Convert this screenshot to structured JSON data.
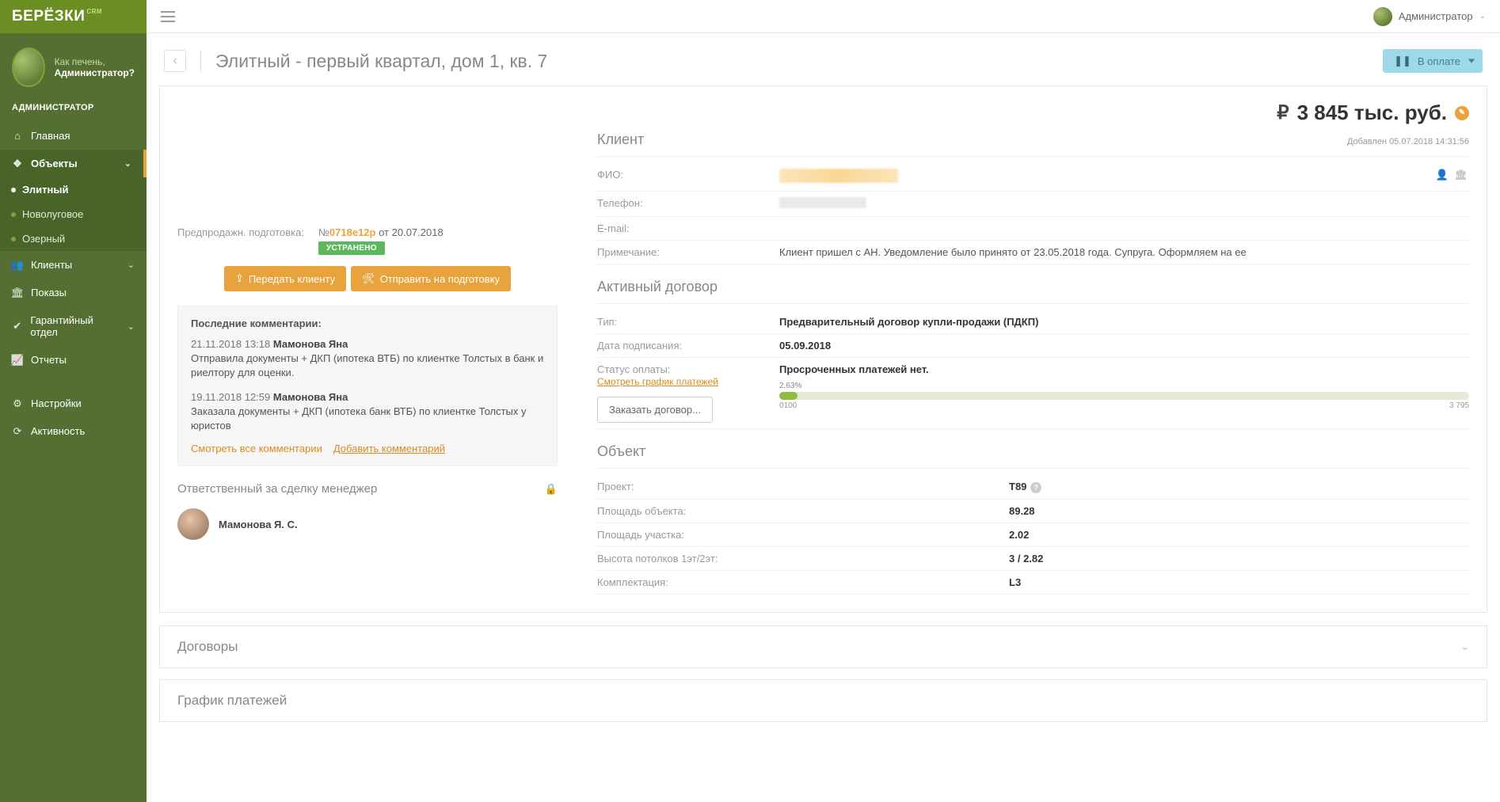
{
  "brand": {
    "name": "БЕРЁЗКИ",
    "suffix": "CRM"
  },
  "user": {
    "greeting": "Как печень,",
    "name": "Администратор?",
    "role_label": "АДМИНИСТРАТОР",
    "top_name": "Администратор"
  },
  "nav": {
    "home": "Главная",
    "objects": "Объекты",
    "objects_sub": {
      "elite": "Элитный",
      "novolug": "Новолуговое",
      "ozern": "Озерный"
    },
    "clients": "Клиенты",
    "shows": "Показы",
    "warranty": "Гарантийный отдел",
    "reports": "Отчеты",
    "settings": "Настройки",
    "activity": "Активность"
  },
  "header": {
    "title": "Элитный - первый квартал, дом 1, кв. 7",
    "status": "В оплате"
  },
  "price": {
    "value": "3 845 тыс. руб."
  },
  "presale": {
    "label": "Предпродажн. подготовка:",
    "doc_no_prefix": "№",
    "doc_code": "0718e12p",
    "doc_date": "от 20.07.2018",
    "badge": "УСТРАНЕНО",
    "btn_transfer": "Передать клиенту",
    "btn_send": "Отправить на подготовку"
  },
  "comments": {
    "heading": "Последние комментарии:",
    "items": [
      {
        "ts": "21.11.2018 13:18",
        "author": "Мамонова Яна",
        "text": "Отправила документы + ДКП (ипотека ВТБ) по клиентке Толстых в банк и риелтору для оценки."
      },
      {
        "ts": "19.11.2018 12:59",
        "author": "Мамонова Яна",
        "text": "Заказала документы + ДКП (ипотека банк ВТБ) по клиентке Толстых у юристов"
      }
    ],
    "view_all": "Смотреть все комментарии",
    "add": "Добавить комментарий"
  },
  "manager": {
    "title": "Ответственный за сделку менеджер",
    "name": "Мамонова Я. С."
  },
  "client": {
    "heading": "Клиент",
    "added": "Добавлен 05.07.2018 14:31:56",
    "fio_label": "ФИО:",
    "phone_label": "Телефон:",
    "email_label": "E-mail:",
    "note_label": "Примечание:",
    "note_value": "Клиент пришел с АН. Уведомление было принято от 23.05.2018 года. Супруга. Оформляем на ее"
  },
  "contract": {
    "heading": "Активный договор",
    "type_label": "Тип:",
    "type_value": "Предварительный договор купли-продажи (ПДКП)",
    "signed_label": "Дата подписания:",
    "signed_value": "05.09.2018",
    "pay_status_label": "Статус оплаты:",
    "pay_status_value": "Просроченных платежей нет.",
    "schedule_link": "Смотреть график платежей",
    "progress_pct": "2.63%",
    "progress_min": "0100",
    "progress_max": "3 795",
    "order_btn": "Заказать договор..."
  },
  "object": {
    "heading": "Объект",
    "project_label": "Проект:",
    "project_value": "Т89",
    "area_label": "Площадь объекта:",
    "area_value": "89.28",
    "land_label": "Площадь участка:",
    "land_value": "2.02",
    "ceiling_label": "Высота потолков 1эт/2эт:",
    "ceiling_value": "3 / 2.82",
    "complect_label": "Комплектация:",
    "complect_value": "L3"
  },
  "accordions": {
    "contracts": "Договоры",
    "schedule": "График платежей"
  }
}
